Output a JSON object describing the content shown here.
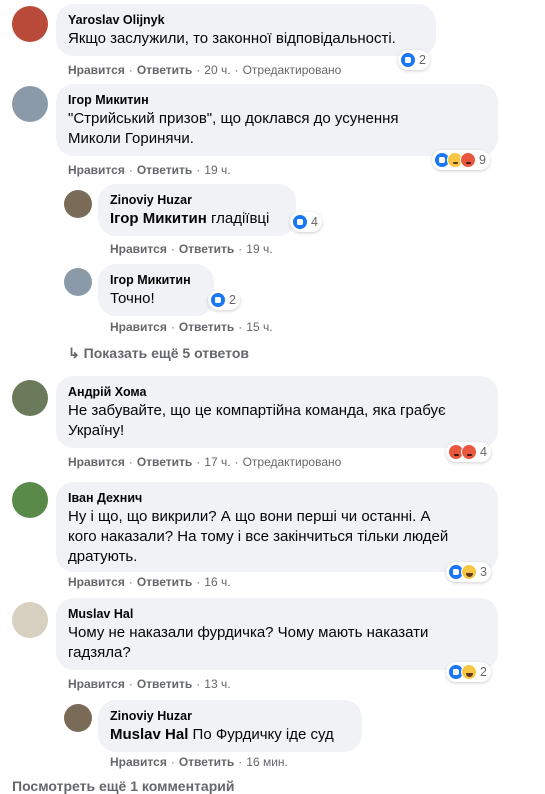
{
  "labels": {
    "like": "Нравится",
    "reply": "Ответить",
    "edited": "Отредактировано",
    "dot": "·"
  },
  "comments": [
    {
      "author": "Yaroslav Olijnyk",
      "text": "Якщо заслужили, то законної відповідальності.",
      "time": "20 ч.",
      "reactions": [
        "like"
      ],
      "count": "2"
    },
    {
      "author": "Ігор Микитин",
      "text_lines": [
        "\"Стрийський призов\", що доклався до усунення",
        "Миколи Горинячи."
      ],
      "time": "19 ч.",
      "reactions": [
        "like",
        "sad",
        "angry"
      ],
      "count": "9"
    },
    {
      "author": "Zinoviy Huzar",
      "mention": "Ігор Микитин",
      "text": " гладіївці",
      "time": "19 ч.",
      "reactions": [
        "like"
      ],
      "count": "4"
    },
    {
      "author": "Ігор Микитин",
      "text": "Точно!",
      "time": "15 ч.",
      "reactions": [
        "like"
      ],
      "count": "2"
    },
    {
      "author": "Андрій Хома",
      "text_lines": [
        "Не забувайте, що це компартійна команда, яка грабує",
        "Україну!"
      ],
      "time": "17 ч.",
      "reactions": [
        "angry",
        "angry"
      ],
      "count": "4"
    },
    {
      "author": "Іван Дехнич",
      "text_lines": [
        "Ну і що, що викрили? А що вони перші чи останні. А",
        "кого наказали? На тому і все закінчиться тільки людей",
        "дратують."
      ],
      "time": "16 ч.",
      "reactions": [
        "like",
        "haha"
      ],
      "count": "3"
    },
    {
      "author": "Muslav Hal",
      "text_lines": [
        "Чому не наказали фурдичка? Чому мають наказати",
        "гадзяла?"
      ],
      "time": "13 ч.",
      "reactions": [
        "like",
        "haha"
      ],
      "count": "2"
    },
    {
      "author": "Zinoviy Huzar",
      "mention": "Muslav Hal",
      "text": " По Фурдичку іде суд",
      "time": "16 мин."
    }
  ],
  "show_more_replies": "Показать ещё 5 ответов",
  "view_more_comments": "Посмотреть ещё 1 комментарий"
}
